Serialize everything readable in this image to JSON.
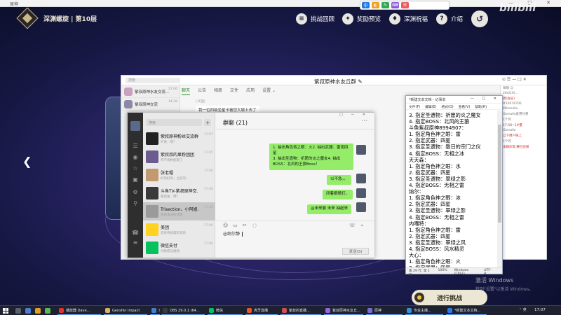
{
  "titlebar": {
    "title": "原神",
    "controls": "— □ ✕"
  },
  "floatbar": {
    "icons": [
      "中",
      "◐",
      "✎",
      "⌨",
      "☰"
    ],
    "colors": [
      "#1f7ae0",
      "#f0a020",
      "#34a853",
      "#8a57d6",
      "#e85b5b"
    ]
  },
  "bilibili": {
    "logo": "bilibili"
  },
  "game": {
    "title": "深渊螺旋 | 第10层",
    "buttons": [
      {
        "label": "挑战回顾",
        "icon": "≡"
      },
      {
        "label": "奖励预览",
        "icon": "✦"
      },
      {
        "label": "深渊祝福",
        "icon": "♦"
      },
      {
        "label": "介绍",
        "icon": "?"
      }
    ],
    "exit_icon": "↺",
    "prev_arrow": "❮",
    "start_label": "进行挑战",
    "watermark": "激活 Windows",
    "watermark_sub": "转到\"设置\"以激活 Windows。"
  },
  "back_window": {
    "search_placeholder": "搜索",
    "title": "紫叔原神水友丘群 ✎",
    "controls": "⊙ ☰ — □ ✕",
    "contacts": [
      {
        "name": "紫叔原神水友交流...",
        "time": "17:06"
      },
      {
        "name": "紫叔原神交流",
        "time": "14:28"
      }
    ],
    "tabs": [
      "聊天",
      "公告",
      "相册",
      "文件",
      "应用",
      "设置 ⌄"
    ],
    "msg_label": "[1F面]",
    "msg": "我一位四级坐星卡被您大城上去了",
    "right_lines": [
      "咩噗 ☺",
      "264/10(...",
      "转(会员)",
      "#10476706",
      "Milkmalle",
      "Gkmalle爱用付费",
      "1个月",
      "17:58~1#量",
      "Gkmalle",
      "以下用户免上",
      "1个月",
      "本群乐等,赛已违规"
    ]
  },
  "wechat": {
    "search_placeholder": "搜索",
    "plus": "+",
    "group_title": "群聊 (21)",
    "more_icon": "···",
    "win_controls": "□ — ✕",
    "chats": [
      {
        "name": "紫叔原神粉丝交流群",
        "preview": "叶某：喂？",
        "time": "17:07",
        "color": "#222222",
        "badge": ""
      },
      {
        "name": "紫叔叔的果粉团团",
        "preview": "咋不闹钟起来了",
        "time": "17:05",
        "color": "#6b5b8f",
        "badge": ""
      },
      {
        "name": "张老帽",
        "preview": "好的好的，之前的...",
        "time": "17:00",
        "color": "#c39a70",
        "badge": ""
      },
      {
        "name": "斗鱼TV-紫叔原神交...",
        "preview": "紫叔鱼：喂？",
        "time": "17:00",
        "color": "#3a3a3a",
        "badge": ""
      },
      {
        "name": "Trisection、小阿姐...",
        "preview": "您有未读的消息",
        "time": "17:00",
        "color": "#9a9a9a",
        "badge": ""
      },
      {
        "name": "美团",
        "preview": "您有待处理的消息",
        "time": "17:00",
        "color": "#ffd21f",
        "badge": ""
      },
      {
        "name": "微信支付",
        "preview": "付款成功通知",
        "time": "17:00",
        "color": "#07c160",
        "badge": ""
      }
    ],
    "messages": [
      {
        "text": "1. 抽出角色将之眼：火2. 抽出武器：雷雨四星\n3. 抽出圣遗物：祈愿的炎之魔女4. 抽出BOSS：北风的王狼Boss！"
      },
      {
        "text": "以不急。。"
      },
      {
        "text": "闭着眼睛打。"
      },
      {
        "text": "@未来展 未来 抽起来"
      }
    ],
    "toolbar_icons": [
      "☺",
      "▭",
      "✂",
      "◌"
    ],
    "toolbar_right": [
      "☏",
      "⌁"
    ],
    "input_text": "@纳尔静",
    "send_label": "发送(S)",
    "sidebar_icons": [
      "☰",
      "◉",
      "☆",
      "▣",
      "⚙",
      "⚲",
      "☎",
      "≡"
    ]
  },
  "notepad": {
    "title": "*新建文本文档 - 记事本",
    "title_controls": "— □ ✕",
    "menu": [
      "文件(F)",
      "编辑(E)",
      "格式(O)",
      "查看(V)",
      "帮助(H)"
    ],
    "lines": [
      "3. 指定圣遗物：祈愿的炎之魔女",
      "4. 指定BOSS：北风的王狼",
      "斗鱼紫叔原神8994907：",
      "1. 指定角色神之眼：雷",
      "2. 指定武器：四星",
      "3. 指定圣遗物：磐日的宗门之仪",
      "4. 指定BOSS：无相之冰",
      "天天森：",
      "1. 指定角色神之眼：水",
      "2. 指定武器：四星",
      "3. 指定圣遗物：翠绿之影",
      "4. 指定BOSS：无相之雷",
      "纳尔：",
      "1. 指定角色神之眼：冰",
      "2. 指定武器：四星",
      "3. 指定圣遗物：翠绿之影",
      "4. 指定BOSS：无相之雷",
      "内嘎特：",
      "1. 指定角色神之眼：雷",
      "2. 指定武器：四星",
      "3. 指定圣遗物：翠绿之风",
      "4. 指定BOSS：风水精灵",
      "大心：",
      "1. 指定角色神之眼：火",
      "2. 指定武器：四星",
      "3. 指定圣遗物：翠绿之影"
    ],
    "status": [
      "第 29 行, 第 1 列",
      "100%",
      "Windows (CRLF)",
      "UTF-8"
    ]
  },
  "taskbar": {
    "apps": [
      {
        "label": "播放器 Dave...",
        "color": "#e2342f"
      },
      {
        "label": "Genshin Impact",
        "color": "#d9b36c"
      },
      {
        "label": "未命名",
        "color": "#4a7bd0"
      },
      {
        "label": "OBS 29.0.1 (64...",
        "color": "#3b3b3b"
      },
      {
        "label": "微信",
        "color": "#07c160"
      },
      {
        "label": "虎牙直播",
        "color": "#e45a2b"
      },
      {
        "label": "紫叔的直播...",
        "color": "#d05050"
      },
      {
        "label": "紫叔原神水友丘...",
        "color": "#9466e0"
      },
      {
        "label": "原神",
        "color": "#7c6bd4"
      },
      {
        "label": "专业主播...",
        "color": "#3a8fd6"
      },
      {
        "label": "*新建文本文档...",
        "color": "#2c7be5"
      }
    ],
    "tray": "⌃ 英",
    "clock": "17:07"
  }
}
